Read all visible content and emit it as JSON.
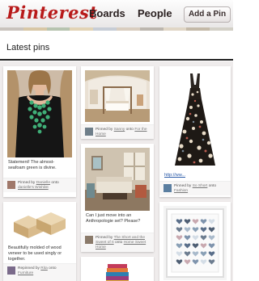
{
  "header": {
    "logo": "Pinterest",
    "nav_boards": "Boards",
    "nav_people": "People",
    "add_pin": "Add a Pin"
  },
  "color_strip": [
    "#c9c3bd",
    "#d8c7a6",
    "#b7c4b0",
    "#e2d3b5",
    "#c7cdd6",
    "#d9cdbf",
    "#bcb6ae",
    "#e0d6c6",
    "#c4b9a8",
    "#d3d0c7"
  ],
  "main": {
    "section_title": "Latest pins"
  },
  "pins": [
    {
      "description": "Statement! The almost-seafoam green is divine.",
      "pinned_by": "Pinned by",
      "user": "Danielle",
      "onto": "onto",
      "board": "danielle's Wishlist"
    },
    {
      "pinned_by": "Pinned by",
      "user": "Sanny",
      "onto": "onto",
      "board": "For the Home"
    },
    {
      "link": "http://ww...",
      "pinned_by": "Pinned by",
      "user": "So Short",
      "onto": "onto",
      "board": "Fashion"
    },
    {
      "description": "Can I just move into an Anthropologie set? Please?",
      "pinned_by": "Pinned by",
      "user": "The Short and the Sweet of It",
      "onto": "onto",
      "board": "Home Sweet Home"
    },
    {
      "description": "Beautifully molded of wood veneer to be used singly or together.",
      "pinned_by": "Repinned by",
      "user": "Rita",
      "onto": "onto",
      "board": "Furniture"
    }
  ]
}
